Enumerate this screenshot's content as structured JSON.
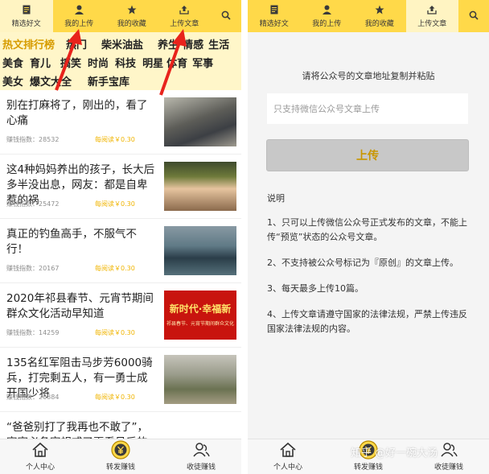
{
  "left": {
    "tabs": [
      {
        "label": "精选好文",
        "icon": "document-icon",
        "active": true
      },
      {
        "label": "我的上传",
        "icon": "user-icon",
        "active": false
      },
      {
        "label": "我的收藏",
        "icon": "star-icon",
        "active": false
      },
      {
        "label": "上传文章",
        "icon": "upload-icon",
        "active": false
      }
    ],
    "categories": [
      [
        "热文排行榜",
        "热门",
        "柴米油盐",
        "养生",
        "情感",
        "生活"
      ],
      [
        "美食",
        "育儿",
        "搞笑",
        "时尚",
        "科技",
        "明星",
        "体育",
        "军事"
      ],
      [
        "美女",
        "爆文大全",
        "新手宝库"
      ]
    ],
    "articles": [
      {
        "title": "别在打麻将了，刚出的，看了心痛",
        "index": "赚钱指数：28532",
        "reward": "每阅读￥0.30"
      },
      {
        "title": "这4种妈妈养出的孩子，长大后多半没出息，网友：都是自卑惹的祸",
        "index": "赚钱指数：25472",
        "reward": "每阅读￥0.30"
      },
      {
        "title": "真正的钓鱼高手，不服气不行！",
        "index": "赚钱指数：20167",
        "reward": "每阅读￥0.30"
      },
      {
        "title": "2020年祁县春节、元宵节期间群众文化活动早知道",
        "index": "赚钱指数：14259",
        "reward": "每阅读￥0.30",
        "thumb_big": "新时代·幸福新",
        "thumb_small": "祁县春节、元宵节期间群众文化"
      },
      {
        "title": "135名红军阻击马步芳6000骑兵，打完剩五人，有一勇士成开国少将",
        "index": "赚钱指数：26884",
        "reward": "每阅读￥0.30"
      },
      {
        "title": "“爸爸别打了我再也不敢了”，家家必备家规戒了再看见后的",
        "index": "",
        "reward": ""
      }
    ],
    "bottom_nav": [
      {
        "label": "个人中心",
        "icon": "home-icon"
      },
      {
        "label": "转发赚钱",
        "icon": "coin-icon"
      },
      {
        "label": "收徒赚钱",
        "icon": "people-icon"
      }
    ]
  },
  "right": {
    "tabs": [
      {
        "label": "精选好文",
        "icon": "document-icon",
        "active": false
      },
      {
        "label": "我的上传",
        "icon": "user-icon",
        "active": false
      },
      {
        "label": "我的收藏",
        "icon": "star-icon",
        "active": false
      },
      {
        "label": "上传文章",
        "icon": "upload-icon",
        "active": true
      }
    ],
    "prompt": "请将公众号的文章地址复制并粘贴",
    "input_placeholder": "只支持微信公众号文章上传",
    "upload_label": "上传",
    "notes_heading": "说明",
    "notes": [
      "1、只可以上传微信公众号正式发布的文章，不能上传“预览”状态的公众号文章。",
      "2、不支持被公众号标记为『原创』的文章上传。",
      "3、每天最多上传10篇。",
      "4、上传文章请遵守国家的法律法规，严禁上传违反国家法律法规的内容。"
    ],
    "bottom_nav": [
      {
        "label": "个人中心",
        "icon": "home-icon"
      },
      {
        "label": "转发赚钱",
        "icon": "coin-icon"
      },
      {
        "label": "收徒赚钱",
        "icon": "people-icon"
      }
    ],
    "watermark": "知乎 @好一碗大汤"
  },
  "colors": {
    "accent": "#ffd949",
    "category_bg": "#fff6c9",
    "highlight": "#d79c00",
    "reward": "#f0b400",
    "arrow": "#e8231c"
  }
}
